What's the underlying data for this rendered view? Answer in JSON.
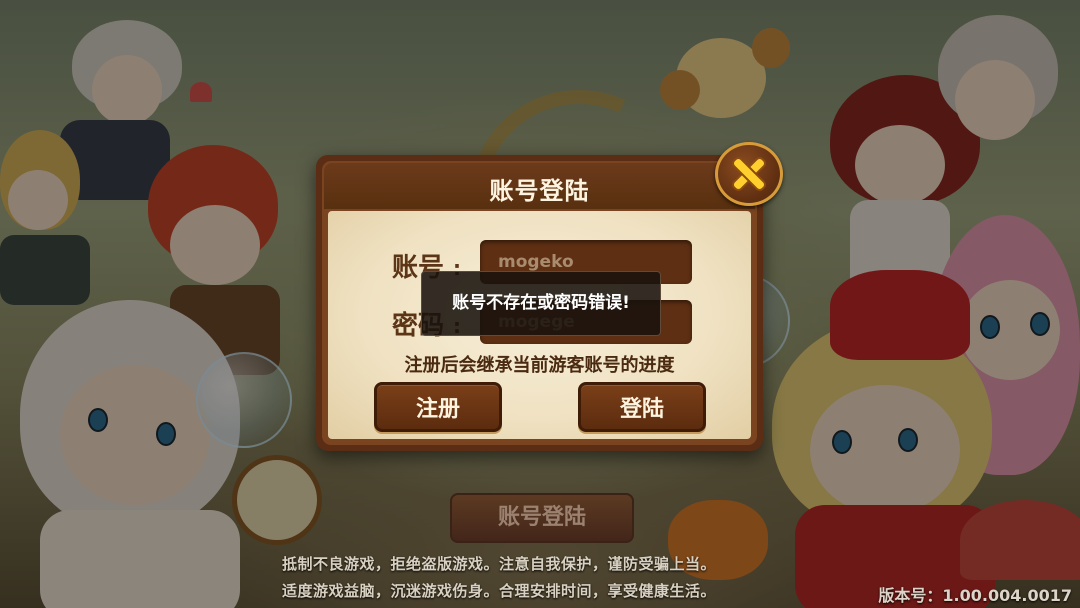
{
  "dialog": {
    "title": "账号登陆",
    "account_label": "账号",
    "password_label": "密码",
    "colon": ":",
    "account_value": "mogeko",
    "password_value": "mogege",
    "hint": "注册后会继承当前游客账号的进度",
    "register_label": "注册",
    "login_label": "登陆",
    "close_icon": "close-icon"
  },
  "toast": {
    "message": "账号不存在或密码错误!"
  },
  "background": {
    "login_button_label": "账号登陆",
    "notice_line1": "抵制不良游戏，拒绝盗版游戏。注意自我保护，谨防受骗上当。",
    "notice_line2": "适度游戏益脑，沉迷游戏伤身。合理安排时间，享受健康生活。",
    "version": "版本号：1.00.004.0017"
  },
  "colors": {
    "dialog_frame": "#5a2d14",
    "dialog_body": "#f8efda",
    "button_fill": "#6b3616",
    "close_x": "#ffcf2e",
    "input_fill": "#5e2f12"
  }
}
